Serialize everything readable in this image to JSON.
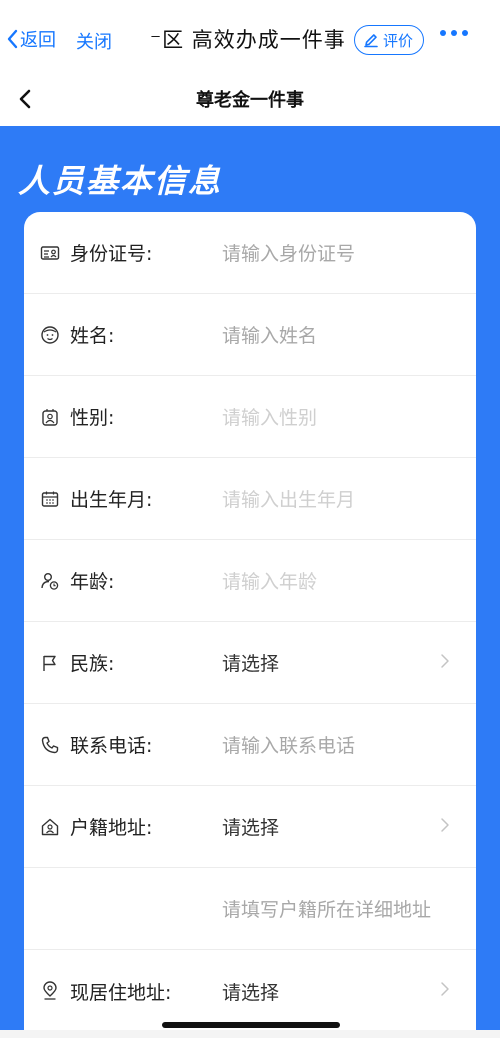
{
  "topbar": {
    "back_label": "返回",
    "close_label": "关闭",
    "title": "⁻区 高效办成一件事",
    "rate_label": "评价"
  },
  "navbar": {
    "title": "尊老金一件事"
  },
  "section": {
    "title": "人员基本信息"
  },
  "colors": {
    "accent": "#1677ff",
    "section_bg": "#2e7bf6"
  },
  "form": {
    "rows": [
      {
        "icon": "id-card-icon",
        "label": "身份证号:",
        "value": "请输入身份证号",
        "kind": "input"
      },
      {
        "icon": "face-icon",
        "label": "姓名:",
        "value": "请输入姓名",
        "kind": "input"
      },
      {
        "icon": "gender-icon",
        "label": "性别:",
        "value": "请输入性别",
        "kind": "readonly"
      },
      {
        "icon": "calendar-icon",
        "label": "出生年月:",
        "value": "请输入出生年月",
        "kind": "readonly"
      },
      {
        "icon": "person-age-icon",
        "label": "年龄:",
        "value": "请输入年龄",
        "kind": "readonly"
      },
      {
        "icon": "flag-icon",
        "label": "民族:",
        "value": "请选择",
        "kind": "select"
      },
      {
        "icon": "phone-icon",
        "label": "联系电话:",
        "value": "请输入联系电话",
        "kind": "input"
      },
      {
        "icon": "home-icon",
        "label": "户籍地址:",
        "value": "请选择",
        "kind": "select"
      },
      {
        "icon": "",
        "label": "",
        "value": "请填写户籍所在详细地址",
        "kind": "input"
      },
      {
        "icon": "location-icon",
        "label": "现居住地址:",
        "value": "请选择",
        "kind": "select"
      }
    ]
  }
}
